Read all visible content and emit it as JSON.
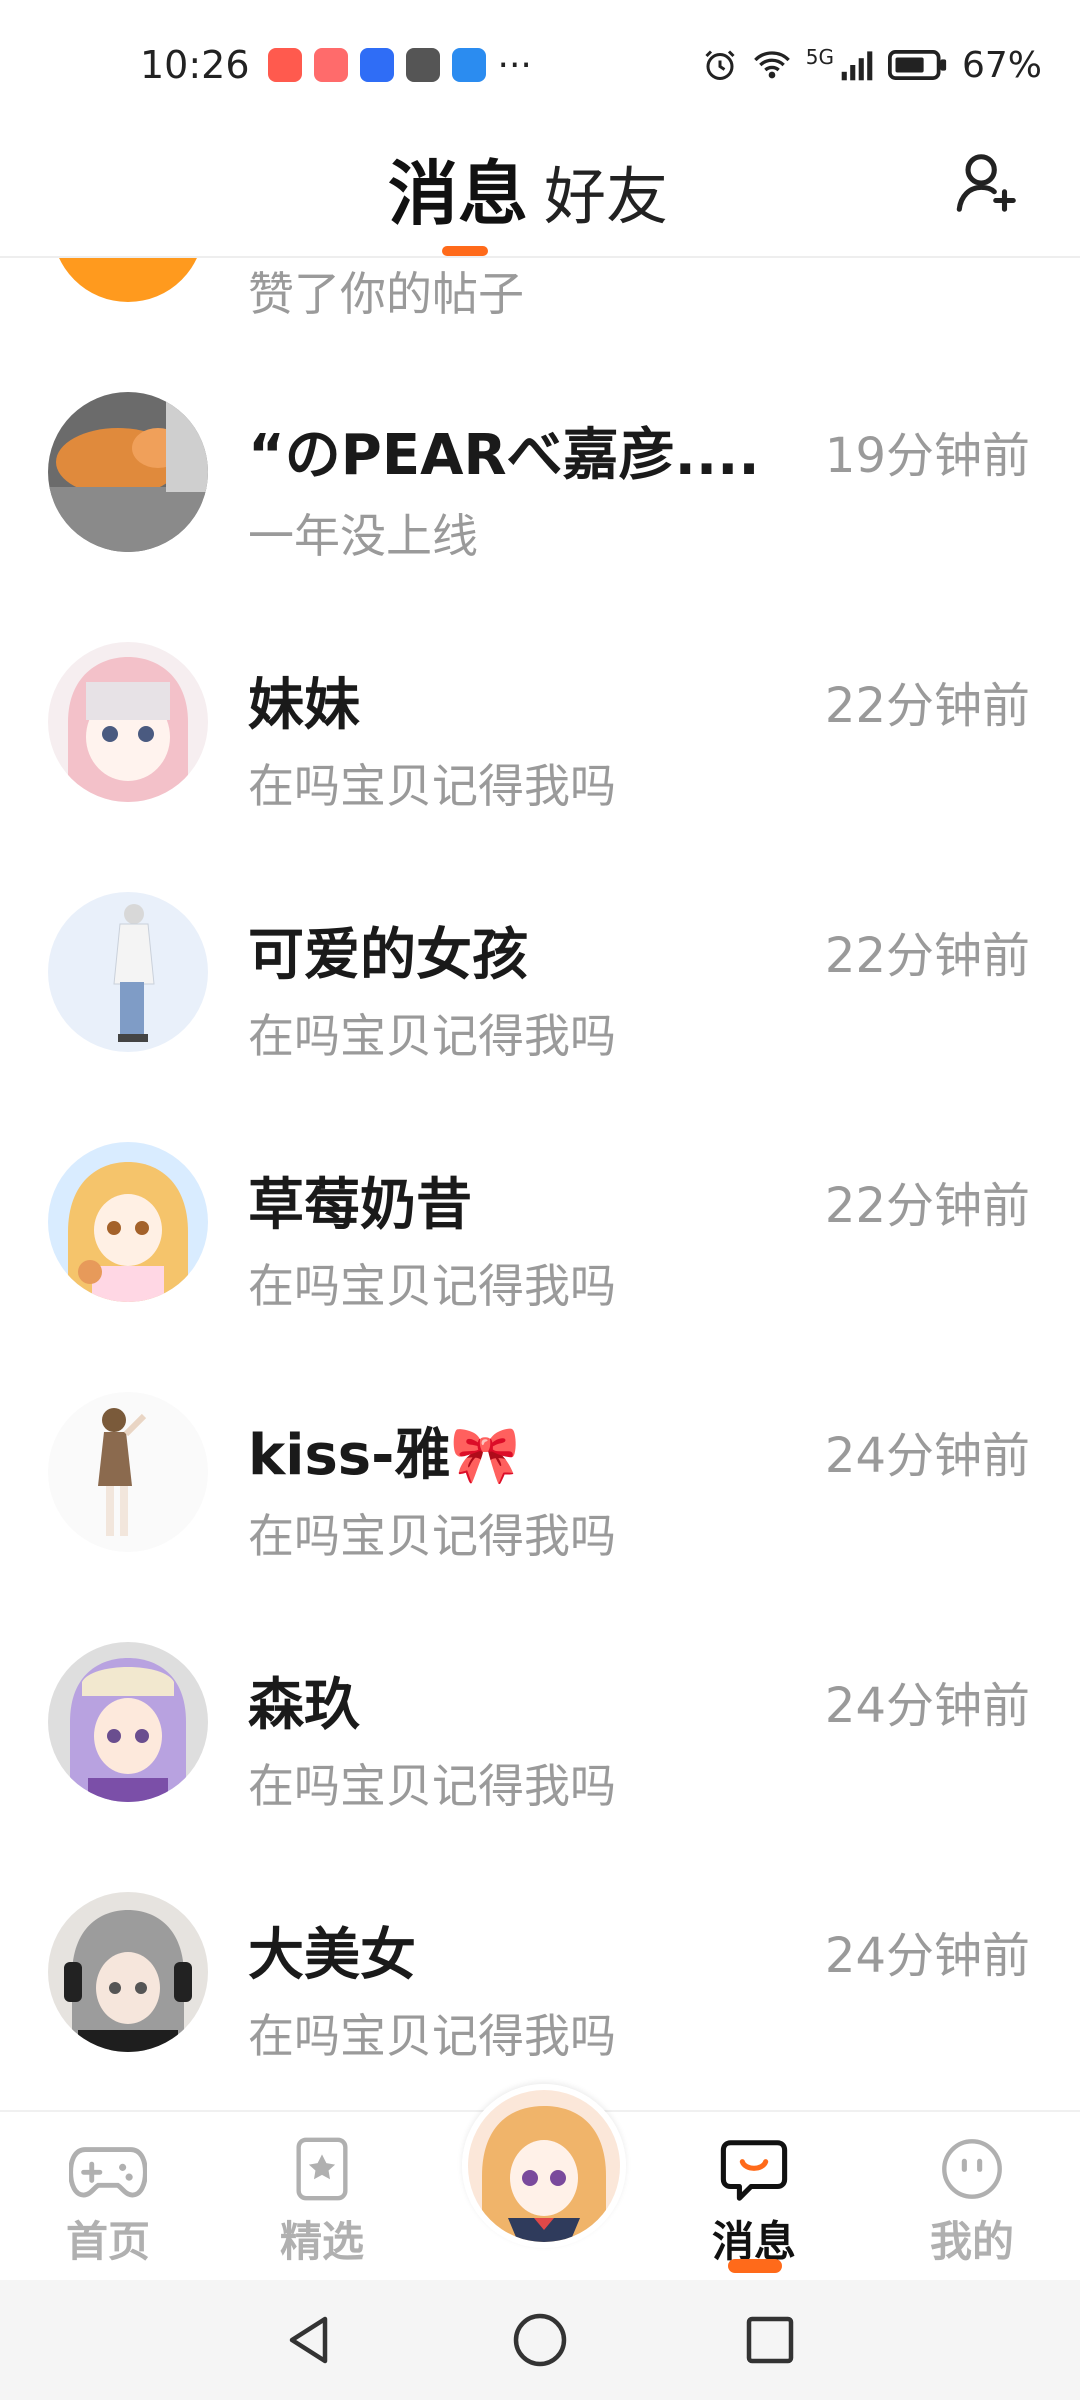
{
  "status_bar": {
    "time": "10:26",
    "network": "5G",
    "battery": "67%",
    "more": "···"
  },
  "header": {
    "tab_messages": "消息",
    "tab_friends": "好友",
    "add_friend_icon": "add-user-icon"
  },
  "partial_item": {
    "preview": "赞了你的帖子"
  },
  "conversations": [
    {
      "name": "“のPEARべ嘉彦....",
      "time": "19分钟前",
      "preview": "一年没上线"
    },
    {
      "name": "妹妹",
      "time": "22分钟前",
      "preview": "在吗宝贝记得我吗"
    },
    {
      "name": "可爱的女孩",
      "time": "22分钟前",
      "preview": "在吗宝贝记得我吗"
    },
    {
      "name": "草莓奶昔",
      "time": "22分钟前",
      "preview": "在吗宝贝记得我吗"
    },
    {
      "name": "kiss-雅🎀",
      "time": "24分钟前",
      "preview": "在吗宝贝记得我吗"
    },
    {
      "name": "森玖",
      "time": "24分钟前",
      "preview": "在吗宝贝记得我吗"
    },
    {
      "name": "大美女",
      "time": "24分钟前",
      "preview": "在吗宝贝记得我吗"
    }
  ],
  "bottom_nav": {
    "home": "首页",
    "featured": "精选",
    "messages": "消息",
    "mine": "我的"
  },
  "colors": {
    "accent": "#ff6a1a",
    "muted": "#9a9a9a"
  }
}
